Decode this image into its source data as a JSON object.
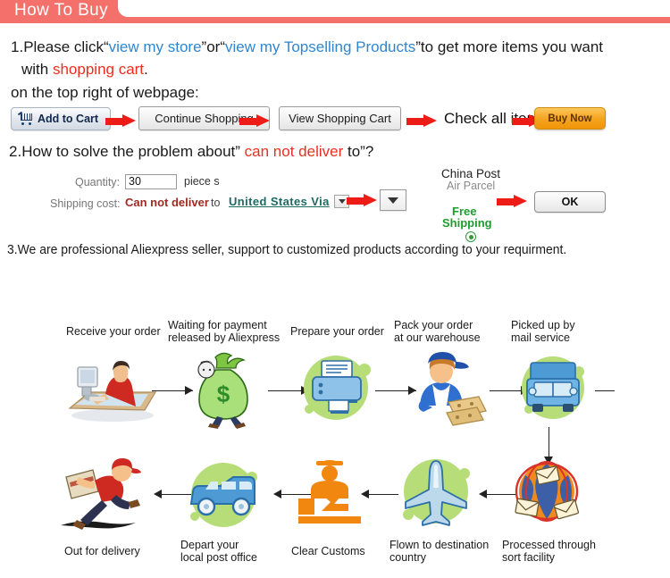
{
  "header": {
    "title": "How To Buy"
  },
  "steps": {
    "one": {
      "num": "1.",
      "lead": "Please click",
      "q1": "“",
      "link1": "view my store",
      "q2": "”",
      "or": "or",
      "q3": "“",
      "link2": "view my Topselling Products",
      "q4": "”",
      "tail": "to get  more items you want",
      "line2_pre": "with",
      "line2_red": "shopping cart",
      "line2_post": ".",
      "line3": "on the top right of webpage:"
    },
    "two": {
      "num": "2.",
      "pre": "How to solve the problem about”",
      "red": "can not deliver",
      "post": "to”?"
    },
    "three": {
      "num": "3.",
      "text": "We are professional Aliexpress seller, support to customized products according to your requirment."
    }
  },
  "buttons": {
    "add_to_cart": "Add to Cart",
    "continue_shopping": "Continue Shopping",
    "view_shopping_cart": "View Shopping Cart",
    "check_all_items": "Check all items",
    "buy_now": "Buy Now",
    "ok": "OK"
  },
  "form": {
    "quantity_label": "Quantity:",
    "quantity_value": "30",
    "piece_unit": "piece s",
    "shipping_label": "Shipping cost:",
    "shipping_status": "Can not deliver",
    "to": "to",
    "country": "United States Via",
    "carrier_line1": "China Post",
    "carrier_line2": "Air Parcel",
    "free_line1": "Free",
    "free_line2": "Shipping"
  },
  "flow": {
    "top": [
      {
        "label": "Receive your order",
        "icon": "person-at-computer-icon"
      },
      {
        "label": "Waiting for payment\nreleased by Aliexpress",
        "icon": "money-bag-icon"
      },
      {
        "label": "Prepare your order",
        "icon": "printer-icon"
      },
      {
        "label": "Pack your order\nat our warehouse",
        "icon": "warehouse-worker-icon"
      },
      {
        "label": "Picked up by\nmail service",
        "icon": "mail-truck-icon"
      }
    ],
    "bottom": [
      {
        "label": "Out for delivery",
        "icon": "running-courier-icon"
      },
      {
        "label": "Depart your\nlocal post office",
        "icon": "delivery-van-icon"
      },
      {
        "label": "Clear Customs",
        "icon": "customs-officer-icon"
      },
      {
        "label": "Flown to destination\ncountry",
        "icon": "airplane-icon"
      },
      {
        "label": "Processed through\nsort facility",
        "icon": "sort-facility-globe-icon"
      }
    ]
  },
  "colors": {
    "banner": "#f4706a",
    "link_blue": "#2f86d0",
    "alert_red": "#ef2d1e",
    "arrow_red": "#ee1c16",
    "buy_now_orange": "#f6a623",
    "free_green": "#1f9b30",
    "blob_green": "#b6dd78",
    "country_teal": "#1c6b63"
  }
}
